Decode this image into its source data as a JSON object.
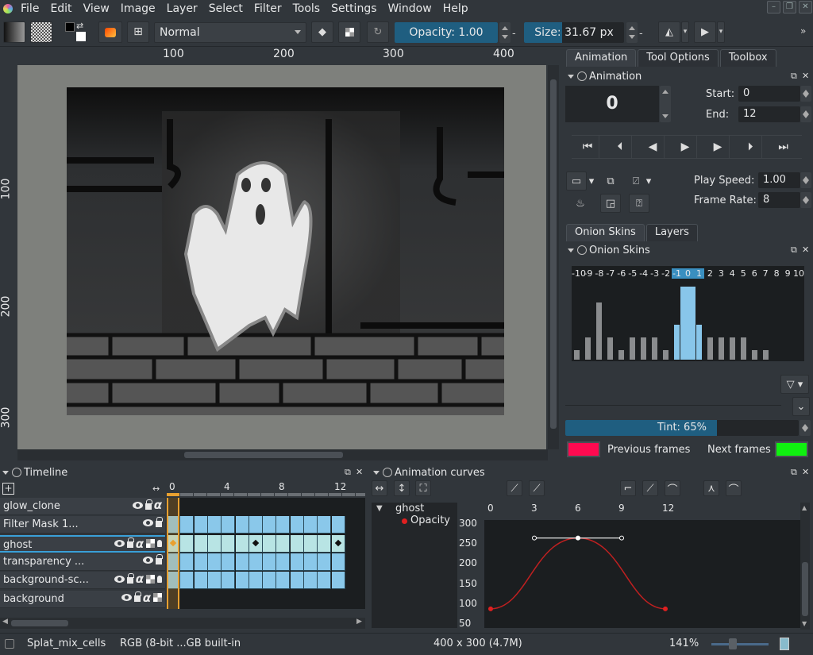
{
  "menubar": {
    "items": [
      "File",
      "Edit",
      "View",
      "Image",
      "Layer",
      "Select",
      "Filter",
      "Tools",
      "Settings",
      "Window",
      "Help"
    ]
  },
  "toolbar": {
    "blend_mode": "Normal",
    "opacity_label": "Opacity: 1.00",
    "opacity_value": 1.0,
    "size_label": "Size: 31.67 px",
    "size_fraction": 0.38,
    "overflow_label": "»"
  },
  "rulers": {
    "horizontal": [
      "100",
      "200",
      "300",
      "400"
    ],
    "vertical": [
      "100",
      "200",
      "300"
    ]
  },
  "right_dock": {
    "top_tabs": [
      "Animation",
      "Tool Options",
      "Toolbox"
    ],
    "animation": {
      "title": "Animation",
      "current_frame": "0",
      "start_label": "Start:",
      "start_value": "0",
      "end_label": "End:",
      "end_value": "12",
      "play_speed_label": "Play Speed:",
      "play_speed_value": "1.00",
      "frame_rate_label": "Frame Rate:",
      "frame_rate_value": "8",
      "transport": [
        "first-frame",
        "previous-keyframe",
        "previous-frame",
        "play",
        "next-frame",
        "next-keyframe",
        "last-frame"
      ]
    },
    "bottom_tabs": [
      "Onion Skins",
      "Layers"
    ],
    "onion": {
      "title": "Onion Skins",
      "offsets": [
        "-10",
        "-9",
        "-8",
        "-7",
        "-6",
        "-5",
        "-4",
        "-3",
        "-2",
        "-1",
        "0",
        "1",
        "2",
        "3",
        "4",
        "5",
        "6",
        "7",
        "8",
        "9",
        "10"
      ],
      "levels": [
        0.1,
        0.23,
        0.6,
        0.23,
        0.1,
        0.23,
        0.23,
        0.23,
        0.1,
        0.37,
        0.77,
        0.37,
        0.23,
        0.23,
        0.23,
        0.23,
        0.1,
        0.1,
        0,
        0,
        0
      ],
      "active": [
        "-1",
        "0",
        "1"
      ],
      "tint_label": "Tint: 65%",
      "tint_value": 0.65,
      "previous_label": "Previous frames",
      "next_label": "Next frames",
      "previous_color": "#ff0a50",
      "next_color": "#10f010"
    }
  },
  "timeline": {
    "title": "Timeline",
    "ruler": [
      "0",
      "4",
      "8",
      "12"
    ],
    "layers": [
      {
        "name": "glow_clone",
        "icons": [
          "eye",
          "lock",
          "alpha"
        ],
        "frames": 0,
        "selected": false
      },
      {
        "name": "Filter Mask 1...",
        "icons": [
          "eye",
          "lock"
        ],
        "frames": 13,
        "selected": false
      },
      {
        "name": "ghost",
        "icons": [
          "eye",
          "lock",
          "alpha",
          "checker",
          "bulb"
        ],
        "frames": 13,
        "selected": true,
        "keyframes": [
          0,
          6,
          12
        ]
      },
      {
        "name": "transparency ...",
        "icons": [
          "eye",
          "lock"
        ],
        "frames": 13,
        "selected": false
      },
      {
        "name": "background-sc...",
        "icons": [
          "eye",
          "lock",
          "alpha",
          "checker",
          "bulb"
        ],
        "frames": 13,
        "selected": false
      },
      {
        "name": "background",
        "icons": [
          "eye",
          "lock",
          "alpha",
          "checker"
        ],
        "frames": 0,
        "selected": false
      }
    ],
    "current_frame": 0
  },
  "curves": {
    "title": "Animation curves",
    "tree_layer": "ghost",
    "tree_channel": "Opacity",
    "x_ticks": [
      "0",
      "3",
      "6",
      "9",
      "12"
    ],
    "y_ticks": [
      "300",
      "250",
      "200",
      "150",
      "100",
      "50"
    ],
    "keys": [
      {
        "frame": 0,
        "value": 88
      },
      {
        "frame": 6,
        "value": 265
      },
      {
        "frame": 12,
        "value": 88
      }
    ]
  },
  "statusbar": {
    "document": "Splat_mix_cells",
    "color_profile": "RGB (8-bit ...GB built-in",
    "dimensions": "400 x 300 (4.7M)",
    "zoom": "141%"
  }
}
